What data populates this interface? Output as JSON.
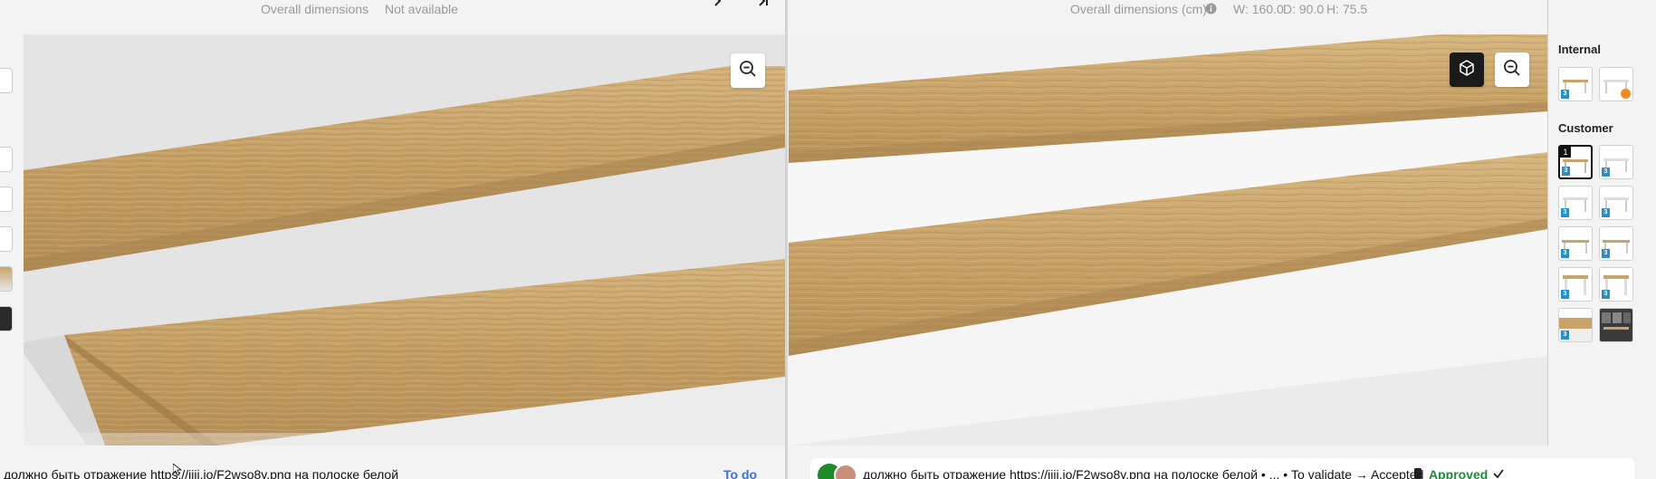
{
  "left_panel": {
    "dimensions_label": "Overall dimensions",
    "dimensions_value": "Not available",
    "comment": "должно быть отражение https://ijij.io/F2wso8y.png на полоске белой",
    "status": "To do"
  },
  "right_panel": {
    "dimensions_label": "Overall dimensions (cm)",
    "width": "W: 160.0",
    "depth": "D: 90.0",
    "height": "H: 75.5",
    "comment": "должно быть отражение https://ijij.io/F2wso8y.png на полоске белой • ... • To validate → Accepted",
    "status": "Approved"
  },
  "sidebar": {
    "internal_heading": "Internal",
    "customer_heading": "Customer",
    "selected_number": "1",
    "badge_label": "3"
  },
  "colors": {
    "wood": "#c9a46a",
    "status_todo": "#3d6fd9",
    "status_approved": "#1e8a3b"
  }
}
